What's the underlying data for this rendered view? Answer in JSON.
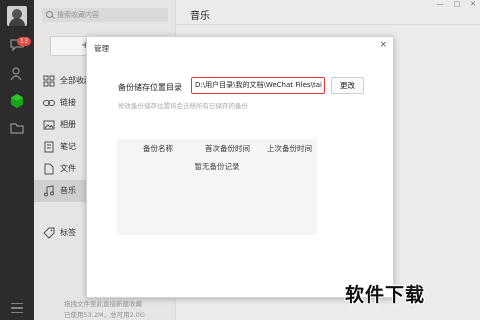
{
  "nav": {
    "badge_count": "13"
  },
  "search": {
    "placeholder": "搜索收藏内容"
  },
  "sidebar": {
    "new_button_label": "+",
    "items": [
      {
        "label": "全部收藏",
        "icon": "grid-icon"
      },
      {
        "label": "链接",
        "icon": "link-icon"
      },
      {
        "label": "相册",
        "icon": "photo-icon"
      },
      {
        "label": "笔记",
        "icon": "note-icon"
      },
      {
        "label": "文件",
        "icon": "file-icon"
      },
      {
        "label": "音乐",
        "icon": "music-icon"
      },
      {
        "label": "标签",
        "icon": "tag-icon"
      }
    ],
    "footer_line1": "拖拽文件至此直接新建收藏",
    "footer_line2": "已使用53.2M，总可用2.0G"
  },
  "content": {
    "title": "音乐",
    "window_buttons": [
      "—",
      "□",
      "✕"
    ]
  },
  "dialog": {
    "title": "管理",
    "close": "×",
    "path_label": "备份储存位置目录",
    "path_value": "D:\\用户目录\\我的文档\\WeChat Files\\tai",
    "change_button": "更改",
    "hint": "修改备份储存位置将会迁移所有已储存的备份",
    "columns": [
      "备份名称",
      "首次备份时间",
      "上次备份时间"
    ],
    "empty_text": "暂无备份记录"
  },
  "watermark": "软件下载",
  "colors": {
    "highlight_border": "#e23a3a",
    "nav_bg": "#2e2e2e",
    "favorite_green": "#1aad19"
  }
}
